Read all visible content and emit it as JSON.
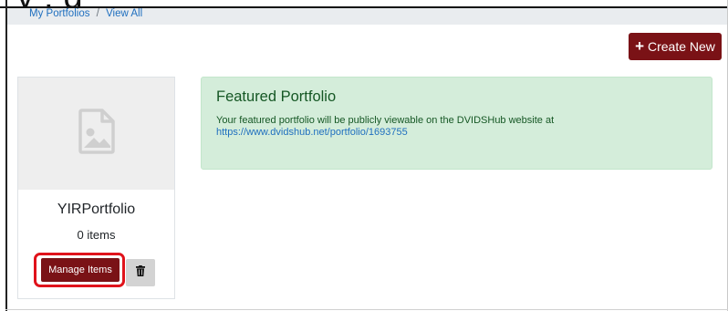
{
  "caption": {
    "text": "y    ,                    g"
  },
  "breadcrumb": {
    "items": [
      "My Portfolios",
      "View All"
    ],
    "separator": "/"
  },
  "actions": {
    "create_label": "Create New",
    "create_icon": "plus-icon"
  },
  "portfolio_card": {
    "name": "YIRPortfolio",
    "count_text": "0 items",
    "manage_label": "Manage Items",
    "thumb_icon": "image-placeholder-icon",
    "delete_icon": "trash-icon"
  },
  "featured": {
    "heading": "Featured Portfolio",
    "description": "Your featured portfolio will be publicly viewable on the DVIDSHub website at",
    "url": "https://www.dvidshub.net/portfolio/1693755"
  },
  "colors": {
    "primary": "#7a1216",
    "highlight": "#e0131b",
    "alert_bg": "#d4edda",
    "alert_text": "#155724",
    "link": "#1f6fbf"
  }
}
